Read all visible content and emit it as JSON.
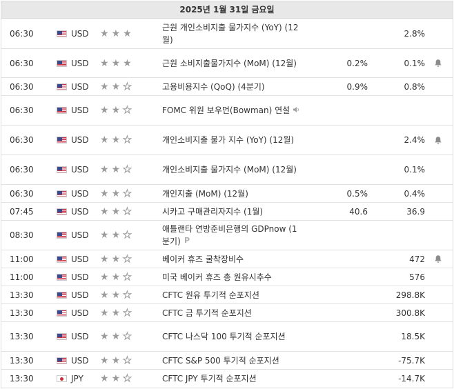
{
  "header": {
    "date": "2025년 1월 31일 금요일"
  },
  "rows": [
    {
      "time": "06:30",
      "flag": "us-flag-icon",
      "currency": "USD",
      "importance": 3,
      "event": "근원 개인소비지출 물가지수 (YoY) (12월)",
      "previous": "",
      "forecast": "2.8%",
      "alert": false,
      "icon": ""
    },
    {
      "time": "06:30",
      "flag": "us-flag-icon",
      "currency": "USD",
      "importance": 3,
      "event": "근원 소비지출물가지수 (MoM) (12월)",
      "previous": "0.2%",
      "forecast": "0.1%",
      "alert": true,
      "icon": ""
    },
    {
      "time": "06:30",
      "flag": "us-flag-icon",
      "currency": "USD",
      "importance": 2,
      "event": "고용비용지수 (QoQ) (4분기)",
      "previous": "0.9%",
      "forecast": "0.8%",
      "alert": false,
      "icon": ""
    },
    {
      "time": "06:30",
      "flag": "us-flag-icon",
      "currency": "USD",
      "importance": 2,
      "event": "FOMC 위원 보우먼(Bowman) 연설",
      "previous": "",
      "forecast": "",
      "alert": false,
      "icon": "speaker-icon"
    },
    {
      "time": "06:30",
      "flag": "us-flag-icon",
      "currency": "USD",
      "importance": 2,
      "event": "개인소비지출 물가 지수 (YoY) (12월)",
      "previous": "",
      "forecast": "2.4%",
      "alert": true,
      "icon": ""
    },
    {
      "time": "06:30",
      "flag": "us-flag-icon",
      "currency": "USD",
      "importance": 2,
      "event": "개인소비지출 물가지수 (MoM) (12월)",
      "previous": "",
      "forecast": "0.1%",
      "alert": false,
      "icon": ""
    },
    {
      "time": "06:30",
      "flag": "us-flag-icon",
      "currency": "USD",
      "importance": 2,
      "event": "개인지출 (MoM) (12월)",
      "previous": "0.5%",
      "forecast": "0.4%",
      "alert": false,
      "icon": ""
    },
    {
      "time": "07:45",
      "flag": "us-flag-icon",
      "currency": "USD",
      "importance": 2,
      "event": "시카고 구매관리자지수 (1월)",
      "previous": "40.6",
      "forecast": "36.9",
      "alert": false,
      "icon": ""
    },
    {
      "time": "08:30",
      "flag": "us-flag-icon",
      "currency": "USD",
      "importance": 2,
      "event": "애틀랜타 연방준비은행의 GDPnow (1분기)",
      "previous": "",
      "forecast": "",
      "alert": false,
      "icon": "preliminary-icon"
    },
    {
      "time": "11:00",
      "flag": "us-flag-icon",
      "currency": "USD",
      "importance": 2,
      "event": "베이커 휴즈 굴착장비수",
      "previous": "",
      "forecast": "472",
      "alert": true,
      "icon": ""
    },
    {
      "time": "11:00",
      "flag": "us-flag-icon",
      "currency": "USD",
      "importance": 2,
      "event": "미국 베이커 휴즈 총 원유시추수",
      "previous": "",
      "forecast": "576",
      "alert": false,
      "icon": ""
    },
    {
      "time": "13:30",
      "flag": "us-flag-icon",
      "currency": "USD",
      "importance": 2,
      "event": "CFTC 원유 투기적 순포지션",
      "previous": "",
      "forecast": "298.8K",
      "alert": false,
      "icon": ""
    },
    {
      "time": "13:30",
      "flag": "us-flag-icon",
      "currency": "USD",
      "importance": 2,
      "event": "CFTC 금 투기적 순포지션",
      "previous": "",
      "forecast": "300.8K",
      "alert": false,
      "icon": ""
    },
    {
      "time": "13:30",
      "flag": "us-flag-icon",
      "currency": "USD",
      "importance": 2,
      "event": "CFTC 나스닥 100 투기적 순포지션",
      "previous": "",
      "forecast": "18.5K",
      "alert": false,
      "icon": ""
    },
    {
      "time": "13:30",
      "flag": "us-flag-icon",
      "currency": "USD",
      "importance": 2,
      "event": "CFTC S&P 500 투기적 순포지션",
      "previous": "",
      "forecast": "-75.7K",
      "alert": false,
      "icon": ""
    },
    {
      "time": "13:30",
      "flag": "japan-flag-icon",
      "currency": "JPY",
      "importance": 2,
      "event": "CFTC JPY 투기적 순포지션",
      "previous": "",
      "forecast": "-14.7K",
      "alert": false,
      "icon": ""
    }
  ]
}
